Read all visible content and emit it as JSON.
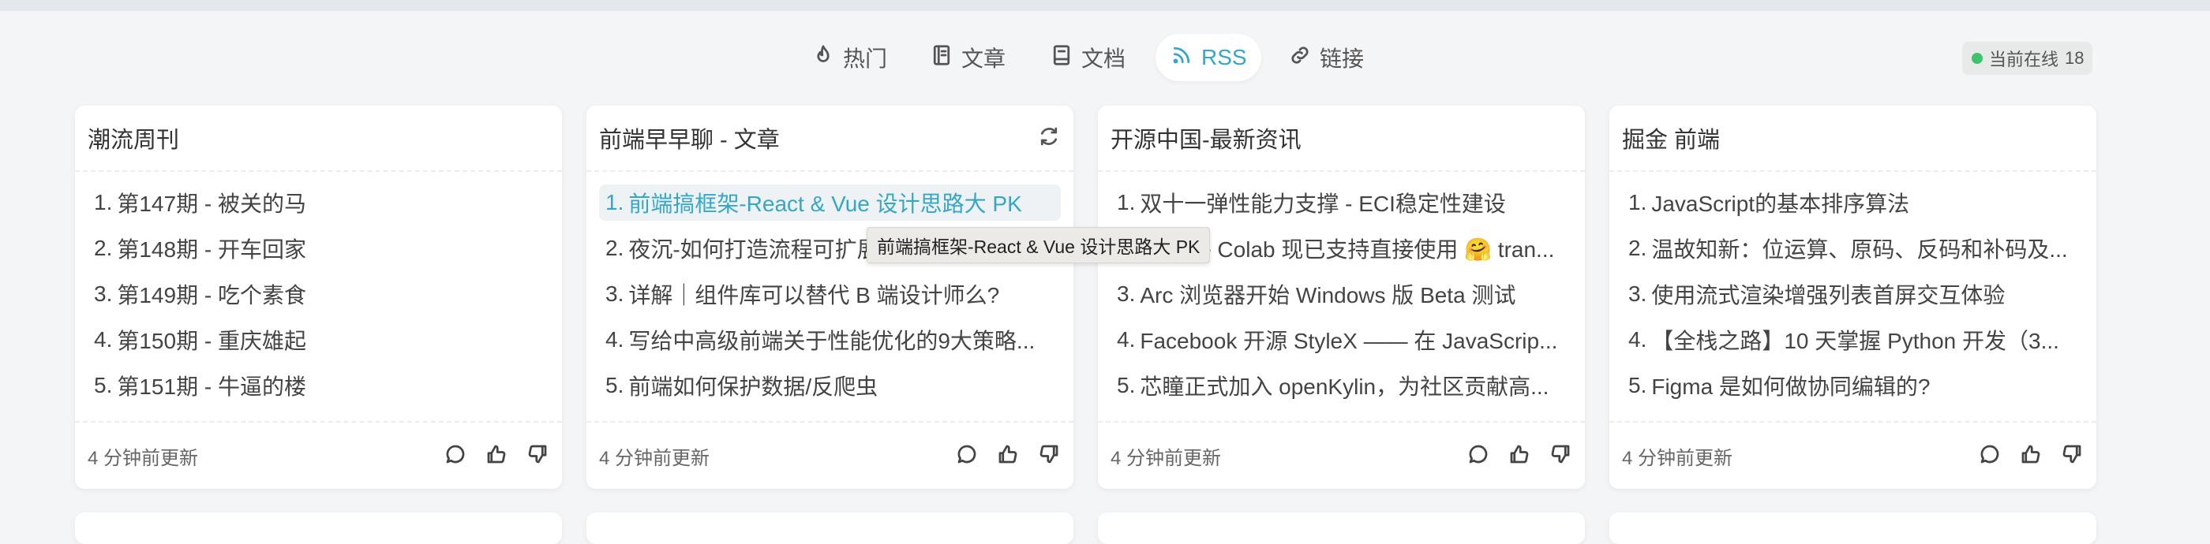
{
  "tabs": [
    {
      "label": "热门",
      "icon": "flame-icon",
      "active": false
    },
    {
      "label": "文章",
      "icon": "book-icon",
      "active": false
    },
    {
      "label": "文档",
      "icon": "document-icon",
      "active": false
    },
    {
      "label": "RSS",
      "icon": "rss-icon",
      "active": true
    },
    {
      "label": "链接",
      "icon": "link-icon",
      "active": false
    }
  ],
  "online": {
    "label": "当前在线",
    "count": "18",
    "status_color": "#3cc46d"
  },
  "accent_color": "#35a7c6",
  "cards": [
    {
      "title": "潮流周刊",
      "items": [
        {
          "num": "1.",
          "title": "第147期 - 被关的马"
        },
        {
          "num": "2.",
          "title": "第148期 - 开车回家"
        },
        {
          "num": "3.",
          "title": "第149期 - 吃个素食"
        },
        {
          "num": "4.",
          "title": "第150期 - 重庆雄起"
        },
        {
          "num": "5.",
          "title": "第151期 - 牛逼的楼"
        }
      ],
      "updated": "4 分钟前更新"
    },
    {
      "title": "前端早早聊 - 文章",
      "items": [
        {
          "num": "1.",
          "title": "前端搞框架-React & Vue 设计思路大 PK"
        },
        {
          "num": "2.",
          "title": "夜沉-如何打造流程可扩展..."
        },
        {
          "num": "3.",
          "title": "详解｜组件库可以替代 B 端设计师么?"
        },
        {
          "num": "4.",
          "title": "写给中高级前端关于性能优化的9大策略..."
        },
        {
          "num": "5.",
          "title": "前端如何保护数据/反爬虫"
        }
      ],
      "updated": "4 分钟前更新",
      "tooltip": "前端搞框架-React & Vue 设计思路大 PK"
    },
    {
      "title": "开源中国-最新资讯",
      "items": [
        {
          "num": "1.",
          "title": "双十一弹性能力支撑 - ECI稳定性建设"
        },
        {
          "num": "2.",
          "title": "Google Colab 现已支持直接使用 🤗 tran..."
        },
        {
          "num": "3.",
          "title": "Arc 浏览器开始 Windows 版 Beta 测试"
        },
        {
          "num": "4.",
          "title": "Facebook 开源 StyleX —— 在 JavaScrip..."
        },
        {
          "num": "5.",
          "title": "芯瞳正式加入 openKylin，为社区贡献高..."
        }
      ],
      "updated": "4 分钟前更新"
    },
    {
      "title": "掘金 前端",
      "items": [
        {
          "num": "1.",
          "title": "JavaScript的基本排序算法"
        },
        {
          "num": "2.",
          "title": "温故知新：位运算、原码、反码和补码及..."
        },
        {
          "num": "3.",
          "title": "使用流式渲染增强列表首屏交互体验"
        },
        {
          "num": "4.",
          "title": "【全栈之路】10 天掌握 Python 开发（3..."
        },
        {
          "num": "5.",
          "title": "Figma 是如何做协同编辑的?"
        }
      ],
      "updated": "4 分钟前更新"
    }
  ]
}
